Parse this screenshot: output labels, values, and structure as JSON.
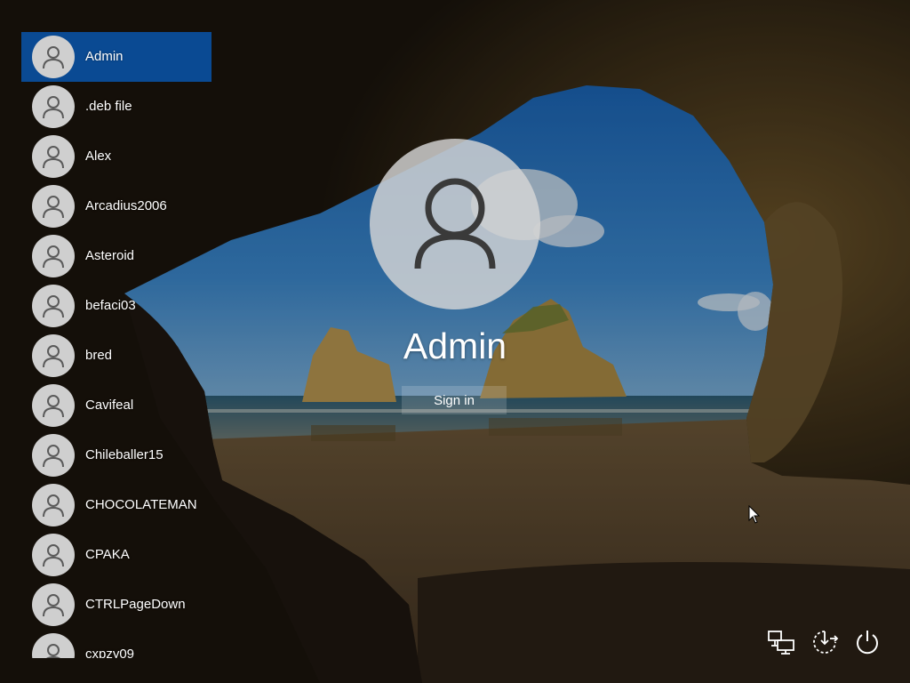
{
  "users": [
    {
      "name": "Admin",
      "selected": true
    },
    {
      "name": ".deb file"
    },
    {
      "name": "Alex"
    },
    {
      "name": "Arcadius2006"
    },
    {
      "name": "Asteroid"
    },
    {
      "name": "befaci03"
    },
    {
      "name": "bred"
    },
    {
      "name": "Cavifeal"
    },
    {
      "name": "Chileballer15"
    },
    {
      "name": "CHOCOLATEMAN"
    },
    {
      "name": "CPAKA"
    },
    {
      "name": "CTRLPageDown"
    },
    {
      "name": "cxpzy09"
    }
  ],
  "signin": {
    "username": "Admin",
    "button_label": "Sign in"
  },
  "system_icons": [
    "network-icon",
    "ease-of-access-icon",
    "power-icon"
  ],
  "colors": {
    "selected_user_bg": "#0a4a93",
    "avatar_bg": "#cfcfcf",
    "text": "#ffffff"
  }
}
